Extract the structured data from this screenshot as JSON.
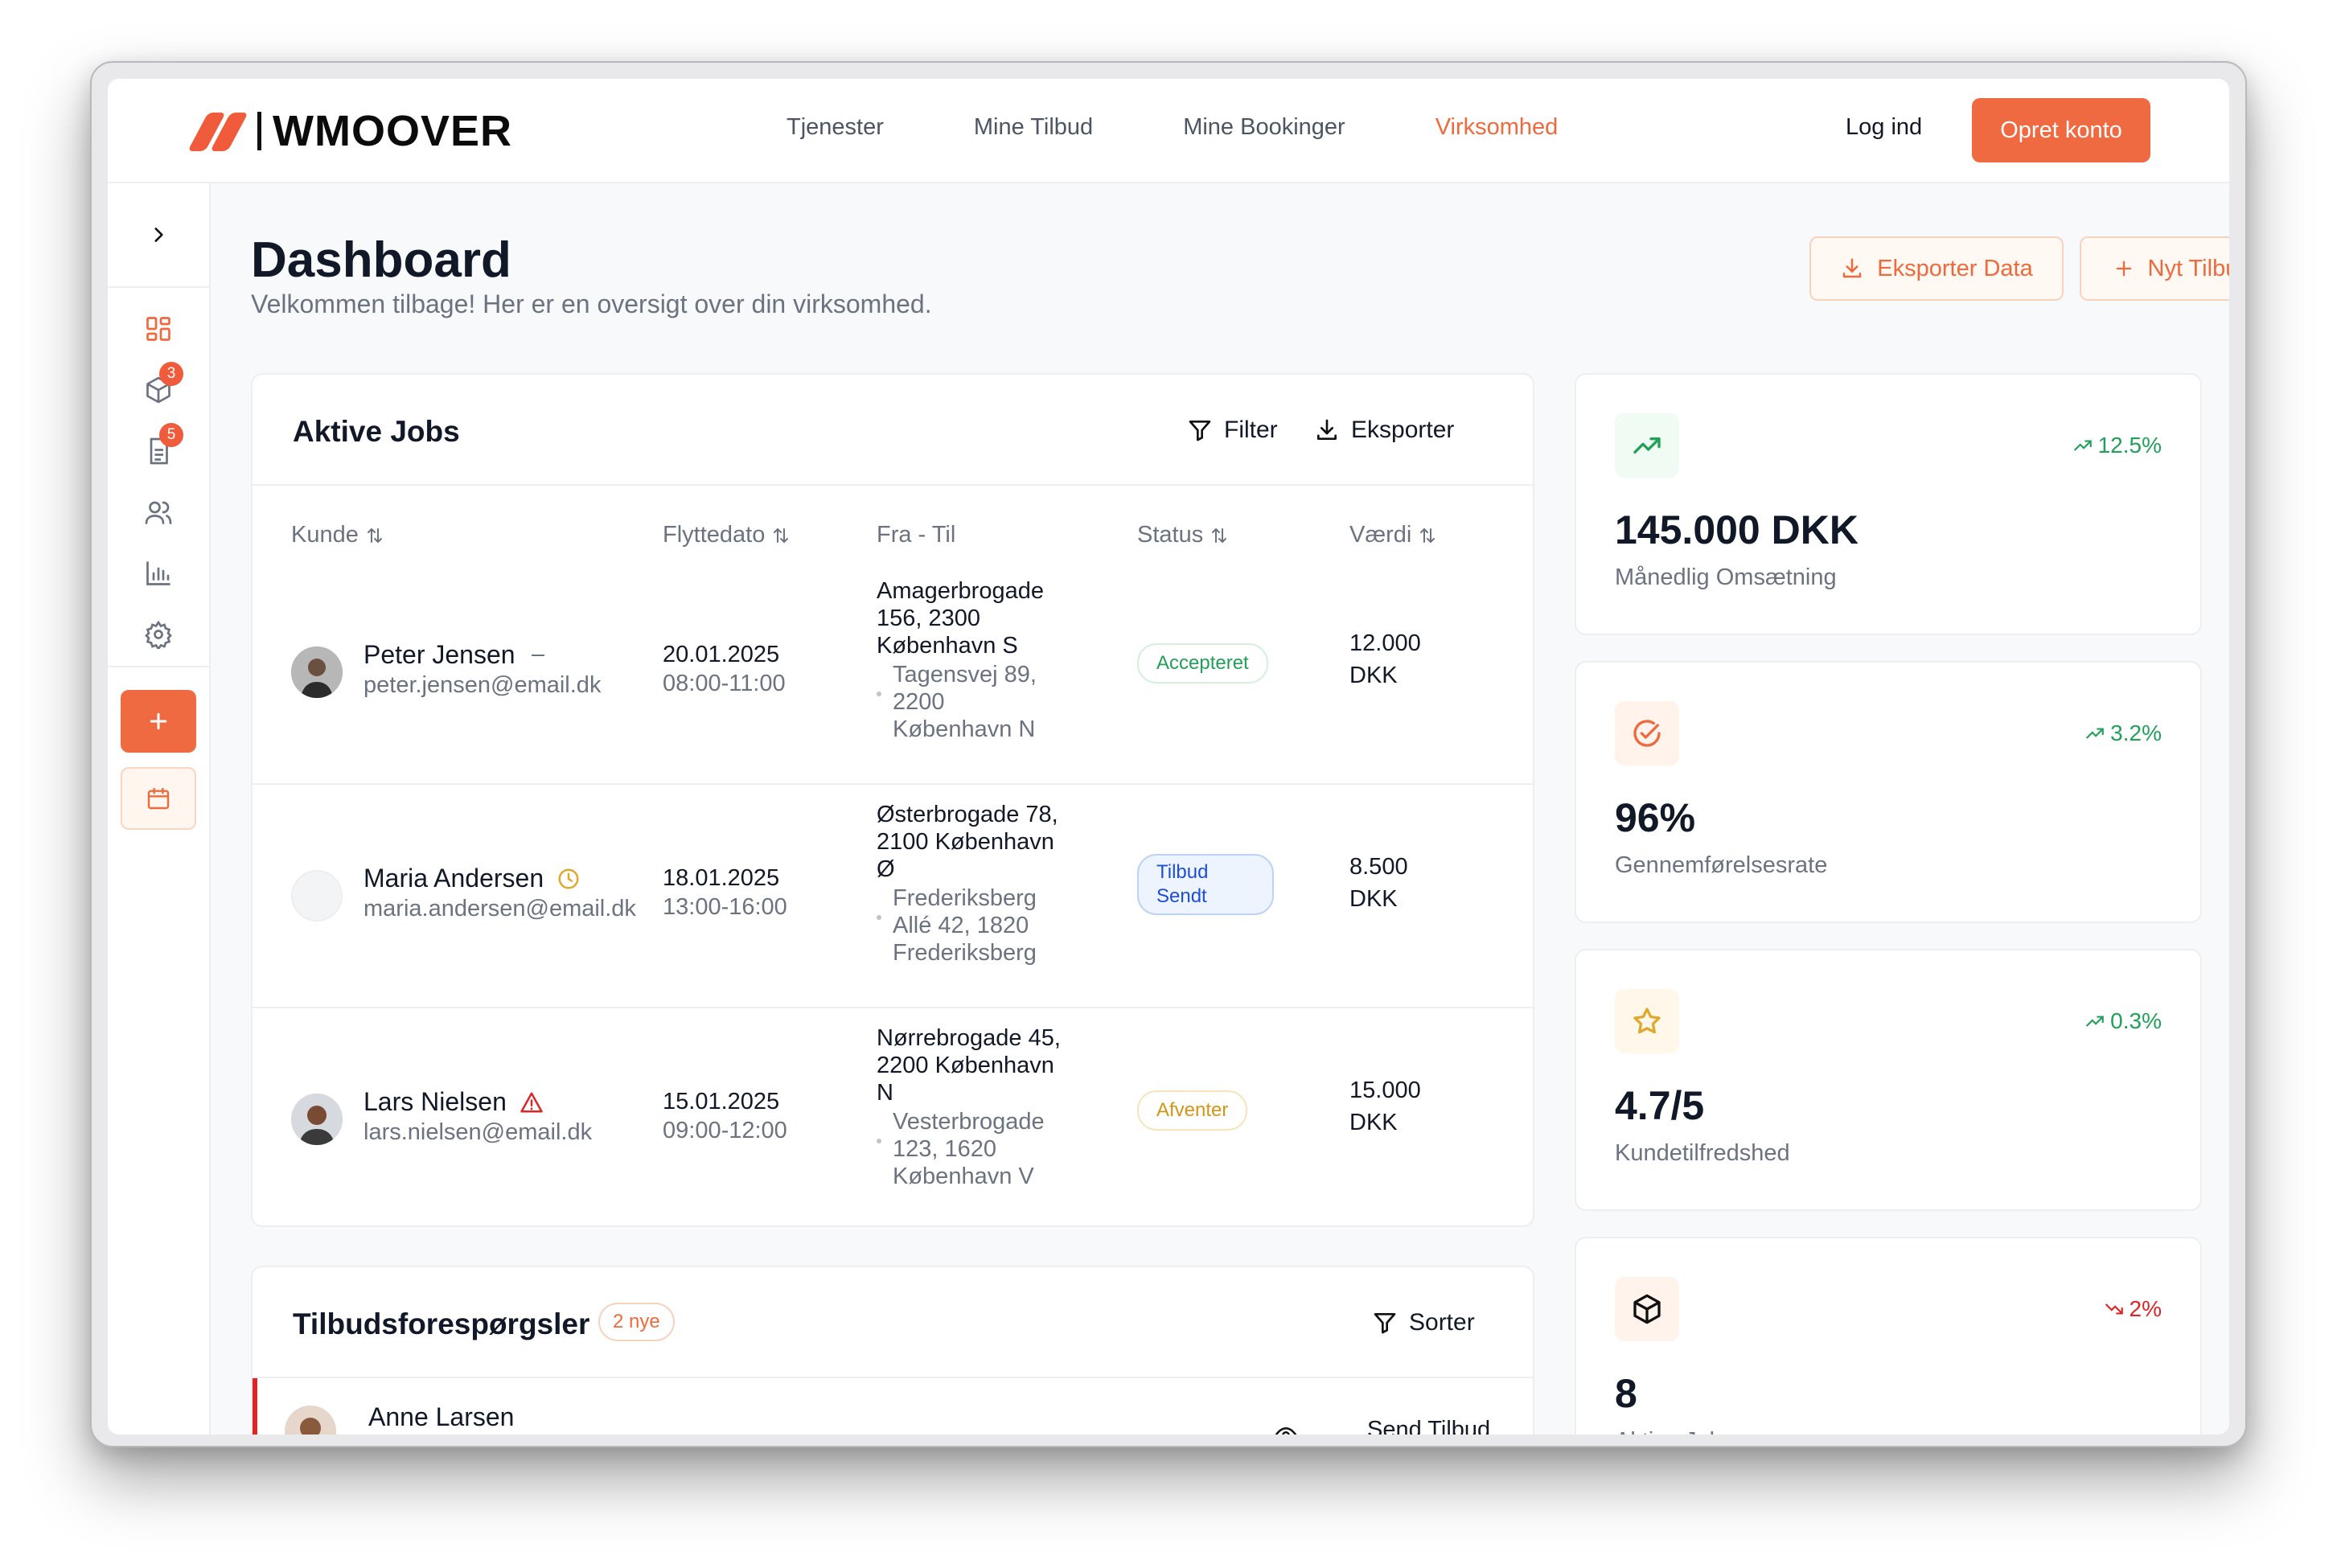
{
  "nav": {
    "brand": "WMOOVER",
    "links": [
      {
        "label": "Tjenester"
      },
      {
        "label": "Mine Tilbud"
      },
      {
        "label": "Mine Bookinger"
      },
      {
        "label": "Virksomhed"
      }
    ],
    "login": "Log ind",
    "signup": "Opret konto"
  },
  "sidebar": {
    "badges": {
      "boxes": "3",
      "docs": "5"
    }
  },
  "header": {
    "title": "Dashboard",
    "subtitle": "Velkommen tilbage! Her er en oversigt over din virksomhed.",
    "export_data": "Eksporter Data",
    "new_offer": "Nyt Tilbud"
  },
  "jobs": {
    "title": "Aktive Jobs",
    "filter": "Filter",
    "export": "Eksporter",
    "columns": [
      "Kunde",
      "Flyttedato",
      "Fra - Til",
      "Status",
      "Værdi"
    ],
    "rows": [
      {
        "name": "Peter Jensen",
        "email": "peter.jensen@email.dk",
        "date": "20.01.2025",
        "time": "08:00-11:00",
        "from": "Amagerbrogade 156, 2300 København S",
        "to": "Tagensvej 89, 2200 København N",
        "status": "Accepteret",
        "value": "12.000 DKK"
      },
      {
        "name": "Maria Andersen",
        "email": "maria.andersen@email.dk",
        "date": "18.01.2025",
        "time": "13:00-16:00",
        "from": "Østerbrogade 78, 2100 København Ø",
        "to": "Frederiksberg Allé 42, 1820 Frederiksberg",
        "status": "Tilbud Sendt",
        "value": "8.500 DKK"
      },
      {
        "name": "Lars Nielsen",
        "email": "lars.nielsen@email.dk",
        "date": "15.01.2025",
        "time": "09:00-12:00",
        "from": "Nørrebrogade 45, 2200 København N",
        "to": "Vesterbrogade 123, 1620 København V",
        "status": "Afventer",
        "value": "15.000 DKK"
      }
    ]
  },
  "requests": {
    "title": "Tilbudsforespørgsler",
    "new_count": "2 nye",
    "sort": "Sorter",
    "first_name": "Anne Larsen",
    "send_offer": "Send Tilbud"
  },
  "stats": [
    {
      "value": "145.000 DKK",
      "label": "Månedlig Omsætning",
      "trend": "12.5%",
      "trend_color": "#22a05a"
    },
    {
      "value": "96%",
      "label": "Gennemførelsesrate",
      "trend": "3.2%",
      "trend_color": "#22a05a"
    },
    {
      "value": "4.7/5",
      "label": "Kundetilfredshed",
      "trend": "0.3%",
      "trend_color": "#22a05a"
    },
    {
      "value": "8",
      "label": "Aktive Jobs",
      "trend": "2%",
      "trend_color": "#dc2626"
    }
  ],
  "colors": {
    "accent": "#ef6a40",
    "positive": "#22a05a",
    "negative": "#dc2626"
  }
}
